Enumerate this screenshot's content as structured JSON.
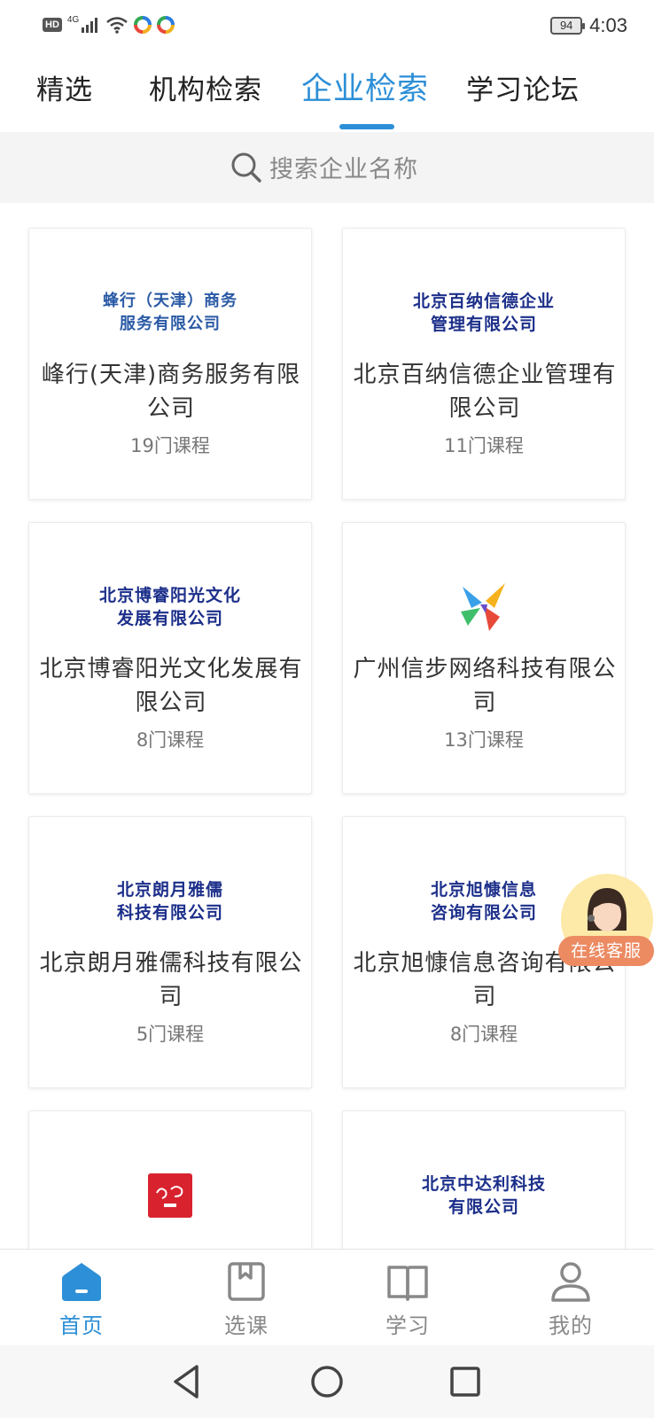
{
  "status_bar": {
    "hd": "HD",
    "network": "4G",
    "battery": "94",
    "time": "4:03"
  },
  "top_tabs": [
    {
      "label": "精选",
      "active": false
    },
    {
      "label": "机构检索",
      "active": false
    },
    {
      "label": "企业检索",
      "active": true
    },
    {
      "label": "学习论坛",
      "active": false
    }
  ],
  "search": {
    "placeholder": "搜索企业名称",
    "icon": "search-icon"
  },
  "companies": [
    {
      "logo_lines": [
        "蜂行（天津）商务",
        "服务有限公司"
      ],
      "name": "峰行(天津)商务服务有限公司",
      "courses": "19门课程"
    },
    {
      "logo_lines": [
        "北京百纳信德企业",
        "管理有限公司"
      ],
      "name": "北京百纳信德企业管理有限公司",
      "courses": "11门课程"
    },
    {
      "logo_lines": [
        "北京博睿阳光文化",
        "发展有限公司"
      ],
      "name": "北京博睿阳光文化发展有限公司",
      "courses": "8门课程"
    },
    {
      "logo_lines": [],
      "name": "广州信步网络科技有限公司",
      "courses": "13门课程"
    },
    {
      "logo_lines": [
        "北京朗月雅儒",
        "科技有限公司"
      ],
      "name": "北京朗月雅儒科技有限公司",
      "courses": "5门课程"
    },
    {
      "logo_lines": [
        "北京旭慷信息",
        "咨询有限公司"
      ],
      "name": "北京旭慷信息咨询有限公司",
      "courses": "8门课程"
    },
    {
      "logo_lines": [],
      "name": "",
      "courses": ""
    },
    {
      "logo_lines": [
        "北京中达利科技",
        "有限公司"
      ],
      "name": "",
      "courses": ""
    }
  ],
  "float_service": {
    "label": "在线客服"
  },
  "bottom_nav": [
    {
      "label": "首页",
      "icon": "home-icon",
      "active": true
    },
    {
      "label": "选课",
      "icon": "bookmark-book-icon",
      "active": false
    },
    {
      "label": "学习",
      "icon": "open-book-icon",
      "active": false
    },
    {
      "label": "我的",
      "icon": "user-icon",
      "active": false
    }
  ],
  "colors": {
    "accent": "#2d8fd7",
    "logo_text": "#1c2f8a",
    "service_badge": "#ec8a62"
  }
}
